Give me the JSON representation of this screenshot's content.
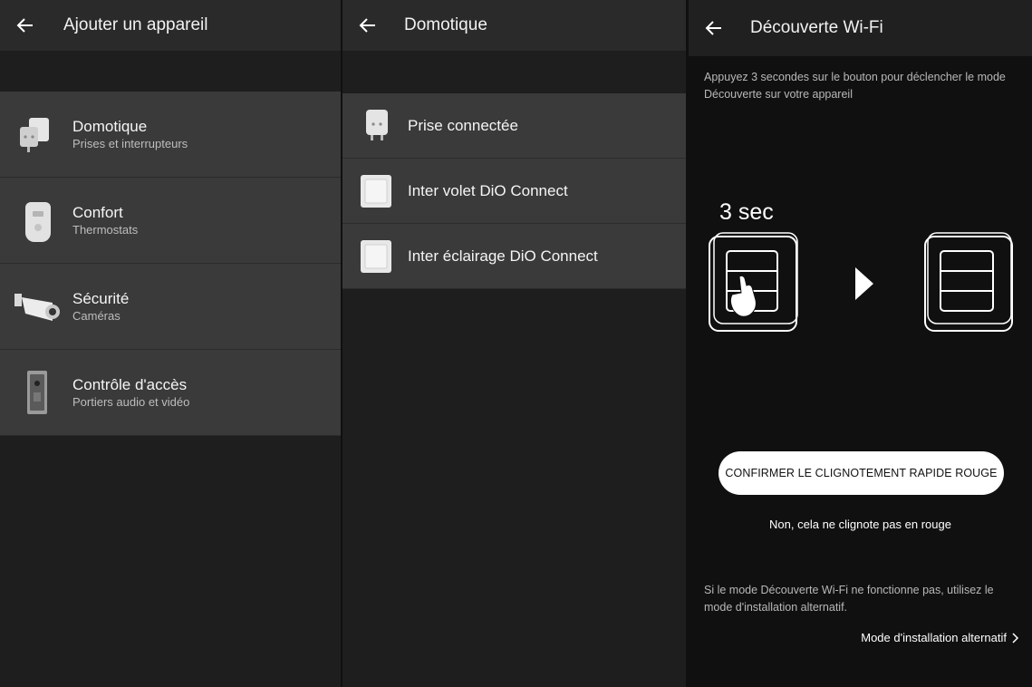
{
  "panel1": {
    "title": "Ajouter un appareil",
    "items": [
      {
        "label": "Domotique",
        "sub": "Prises et interrupteurs",
        "icon": "smart-plug-icon"
      },
      {
        "label": "Confort",
        "sub": "Thermostats",
        "icon": "thermostat-icon"
      },
      {
        "label": "Sécurité",
        "sub": "Caméras",
        "icon": "camera-icon"
      },
      {
        "label": "Contrôle d'accès",
        "sub": "Portiers audio et vidéo",
        "icon": "doorbell-icon"
      }
    ]
  },
  "panel2": {
    "title": "Domotique",
    "items": [
      {
        "label": "Prise connectée",
        "icon": "smart-plug-icon"
      },
      {
        "label": "Inter volet DiO Connect",
        "icon": "shutter-switch-icon"
      },
      {
        "label": "Inter éclairage DiO Connect",
        "icon": "light-switch-icon"
      }
    ]
  },
  "panel3": {
    "title": "Découverte Wi-Fi",
    "instruction": "Appuyez 3 secondes sur le bouton pour déclencher le mode Découverte sur votre appareil",
    "press_duration": "3 sec",
    "confirm_button": "CONFIRMER LE CLIGNOTEMENT RAPIDE ROUGE",
    "no_blink_link": "Non, cela ne clignote pas en rouge",
    "fallback_note": "Si le mode Découverte Wi-Fi ne fonctionne pas, utilisez le mode d'installation alternatif.",
    "alt_mode_link": "Mode d'installation alternatif"
  }
}
